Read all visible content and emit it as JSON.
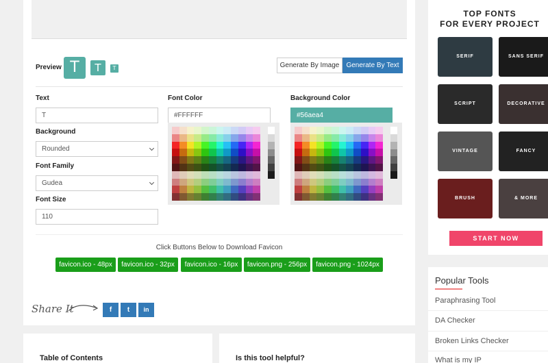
{
  "preview": {
    "label": "Preview",
    "letter": "T"
  },
  "generate": {
    "by_image": "Generate By Image",
    "by_text": "Generate By Text"
  },
  "form": {
    "text_label": "Text",
    "text_value": "T",
    "background_label": "Background",
    "background_value": "Rounded",
    "font_family_label": "Font Family",
    "font_family_value": "Gudea",
    "font_size_label": "Font Size",
    "font_size_value": "110",
    "font_color_label": "Font Color",
    "font_color_value": "#FFFFFF",
    "bg_color_label": "Background Color",
    "bg_color_value": "#56aea4"
  },
  "colors": {
    "accent": "#56aea4",
    "primary": "#337ab7",
    "download": "#1a9e1a",
    "start": "#f0456a"
  },
  "download": {
    "instruction": "Click Buttons Below to Download Favicon",
    "buttons": [
      "favicon.ico - 48px",
      "favicon.ico - 32px",
      "favicon.ico - 16px",
      "favicon.png - 256px",
      "favicon.png - 1024px"
    ]
  },
  "share": {
    "label": "Share It",
    "icons": [
      "facebook-icon",
      "twitter-icon",
      "linkedin-icon"
    ],
    "glyphs": [
      "f",
      "t",
      "in"
    ]
  },
  "sections": {
    "toc": "Table of Contents",
    "helpful": "Is this tool helpful?"
  },
  "ad": {
    "title_line1": "TOP FONTS",
    "title_line2": "FOR EVERY PROJECT",
    "tiles": [
      "SERIF",
      "SANS SERIF",
      "SCRIPT",
      "DECORATIVE",
      "VINTAGE",
      "FANCY",
      "BRUSH",
      "& MORE"
    ],
    "start": "START NOW"
  },
  "popular": {
    "title": "Popular Tools",
    "items": [
      "Paraphrasing Tool",
      "DA Checker",
      "Broken Links Checker",
      "What is my IP"
    ]
  }
}
